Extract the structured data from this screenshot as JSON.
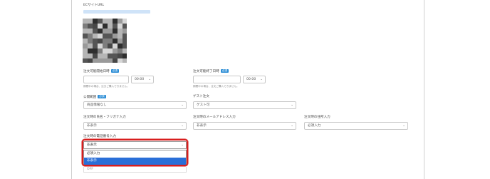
{
  "ec_site_url": {
    "label": "ECサイトURL"
  },
  "badge_required": "必須",
  "order_start": {
    "label": "注文可能開始日時",
    "time": "00:00",
    "hint": "期間中の場合、注文ご購入できません。"
  },
  "order_end": {
    "label": "注文可能終了日時",
    "time": "00:00",
    "hint": "期間中の場合、注文ご購入できません。"
  },
  "publish_scope": {
    "label": "公開範囲",
    "value": "商品情報なし"
  },
  "guest_order": {
    "label": "ゲスト注文",
    "value": "ゲスト可"
  },
  "name_kana": {
    "label": "注文時の氏名・フリガナ入力",
    "value": "非表示"
  },
  "email_input": {
    "label": "注文時のメールアドレス入力",
    "value": "非表示"
  },
  "address_input": {
    "label": "注文時の住所入力",
    "value": "必須入力"
  },
  "phone_input": {
    "label": "注文時の電話番号入力",
    "value": "非表示",
    "options": [
      "必須入力",
      "非表示"
    ],
    "selected_index": 1,
    "below_value": "OFF"
  },
  "colors": {
    "highlight": "#d81e1e",
    "badge": "#2f8fd6",
    "selected": "#2a6fd8"
  }
}
